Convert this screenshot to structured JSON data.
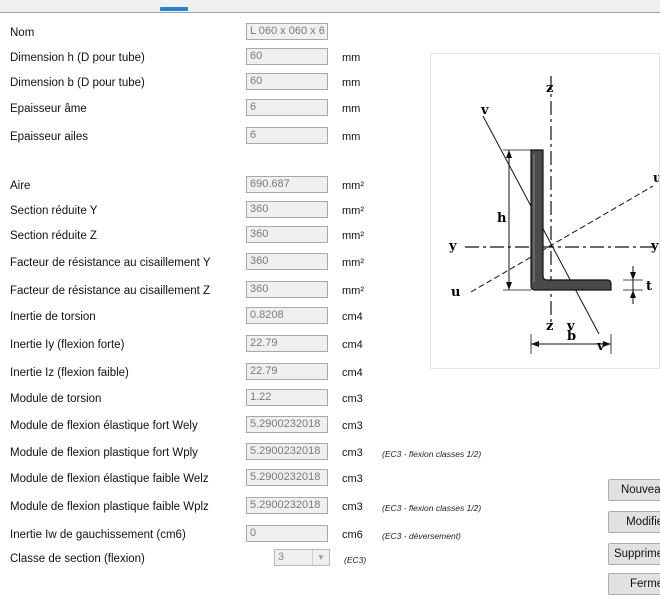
{
  "form": {
    "rows": [
      {
        "label": "Nom",
        "value": "L 060 x 060 x 6",
        "unit": ""
      },
      {
        "label": "Dimension h (D pour tube)",
        "value": "60",
        "unit": "mm"
      },
      {
        "label": "Dimension b (D pour tube)",
        "value": "60",
        "unit": "mm"
      },
      {
        "label": "Epaisseur âme",
        "value": "6",
        "unit": "mm"
      },
      {
        "label": "Epaisseur ailes",
        "value": "6",
        "unit": "mm"
      },
      {
        "label": "Aire",
        "value": "690.687",
        "unit": "mm²"
      },
      {
        "label": "Section réduite Y",
        "value": "360",
        "unit": "mm²"
      },
      {
        "label": "Section réduite Z",
        "value": "360",
        "unit": "mm²"
      },
      {
        "label": "Facteur de résistance au cisaillement Y",
        "value": "360",
        "unit": "mm²"
      },
      {
        "label": "Facteur de résistance au cisaillement Z",
        "value": "360",
        "unit": "mm²"
      },
      {
        "label": "Inertie de torsion",
        "value": "0.8208",
        "unit": "cm4"
      },
      {
        "label": "Inertie Iy (flexion forte)",
        "value": "22.79",
        "unit": "cm4"
      },
      {
        "label": "Inertie Iz (flexion faible)",
        "value": "22.79",
        "unit": "cm4"
      },
      {
        "label": "Module de torsion",
        "value": "1.22",
        "unit": "cm3"
      },
      {
        "label": "Module de flexion élastique fort Wely",
        "value": "5.2900232018",
        "unit": "cm3"
      },
      {
        "label": "Module de flexion plastique fort Wply",
        "value": "5.2900232018",
        "unit": "cm3",
        "note": "(EC3 - flexion classes 1/2)"
      },
      {
        "label": "Module de flexion élastique faible Welz",
        "value": "5.2900232018",
        "unit": "cm3"
      },
      {
        "label": "Module de flexion plastique faible Wplz",
        "value": "5.2900232018",
        "unit": "cm3",
        "note": "(EC3 - flexion classes 1/2)"
      },
      {
        "label": "Inertie Iw de gauchissement (cm6)",
        "value": "0",
        "unit": "cm6",
        "note": "(EC3 - déversement)"
      }
    ],
    "section_class": {
      "label": "Classe de section (flexion)",
      "value": "3",
      "note": "(EC3)"
    }
  },
  "diagram": {
    "axis_labels": {
      "z_top": "z",
      "z_bottom": "z",
      "y_left": "y",
      "y_right": "y",
      "u_left": "u",
      "u_right": "u",
      "v_top": "v",
      "v_bottom": "v",
      "v_mid": "v",
      "h": "h",
      "b": "b",
      "t": "t"
    }
  },
  "buttons": {
    "new": "Nouveau",
    "modify": "Modifier",
    "delete": "Supprimer",
    "close": "Fermer"
  },
  "colors": {
    "accent": "#2a7fd4",
    "field_bg": "#f0f0f0",
    "field_text": "#7a7a7a"
  }
}
